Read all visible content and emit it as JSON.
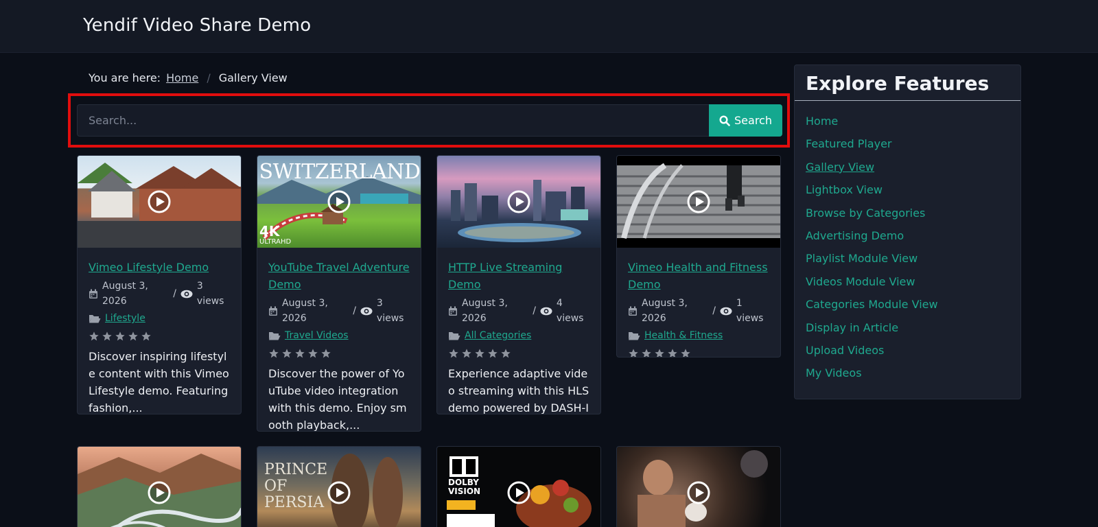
{
  "site": {
    "title": "Yendif Video Share Demo"
  },
  "breadcrumb": {
    "prefix": "You are here:",
    "home": "Home",
    "current": "Gallery View"
  },
  "search": {
    "placeholder": "Search...",
    "button_label": "Search"
  },
  "videos": [
    {
      "title": "Vimeo Lifestyle Demo",
      "date": "August 3, 2026",
      "views": "3 views",
      "category": "Lifestyle",
      "rating": 0,
      "description": "Discover inspiring lifestyle content with this Vimeo Lifestyle demo. Featuring fashion,..."
    },
    {
      "title": "YouTube Travel Adventure Demo",
      "date": "August 3, 2026",
      "views": "3 views",
      "category": "Travel Videos",
      "rating": 0,
      "description": "Discover the power of YouTube video integration with this demo. Enjoy smooth playback,...",
      "thumb_text": {
        "top": "SWITZERLAND",
        "badge": "4K",
        "sub": "ULTRAHD"
      }
    },
    {
      "title": "HTTP Live Streaming Demo",
      "date": "August 3, 2026",
      "views": "4 views",
      "category": "All Categories",
      "rating": 0,
      "description": "Experience adaptive video streaming with this HLS demo powered by DASH-IF Live Simulator. The..."
    },
    {
      "title": "Vimeo Health and Fitness Demo",
      "date": "August 3, 2026",
      "views": "1 views",
      "category": "Health & Fitness",
      "rating": 0,
      "description": ""
    }
  ],
  "second_row_thumbs": [
    {
      "label": ""
    },
    {
      "label": "PRINCE OF PERSIA"
    },
    {
      "label": "DOLBY VISION"
    },
    {
      "label": ""
    }
  ],
  "sidebar": {
    "title": "Explore Features",
    "items": [
      {
        "label": "Home"
      },
      {
        "label": "Featured Player"
      },
      {
        "label": "Gallery View"
      },
      {
        "label": "Lightbox View"
      },
      {
        "label": "Browse by Categories"
      },
      {
        "label": "Advertising Demo"
      },
      {
        "label": "Playlist Module View"
      },
      {
        "label": "Videos Module View"
      },
      {
        "label": "Categories Module View"
      },
      {
        "label": "Display in Article"
      },
      {
        "label": "Upload Videos"
      },
      {
        "label": "My Videos"
      }
    ],
    "active_item": "Gallery View"
  },
  "colors": {
    "accent": "#14a88f",
    "link": "#1fa98f",
    "highlight_border": "#e10d0d",
    "page_bg": "#0b0f18",
    "card_bg": "#1a1f2c"
  }
}
